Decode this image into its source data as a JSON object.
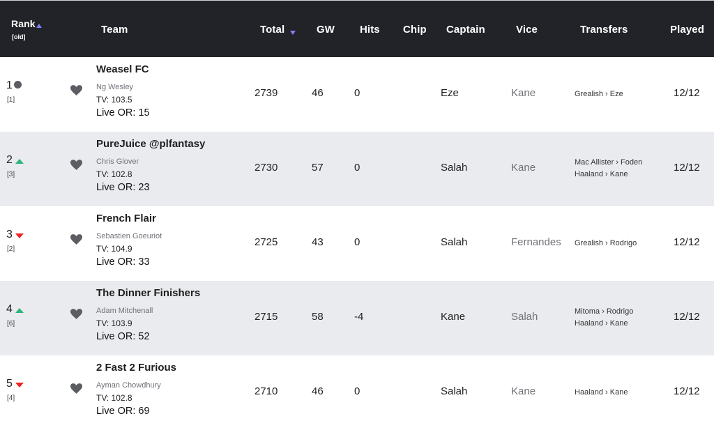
{
  "header": {
    "rank": "Rank",
    "rank_old": "[old]",
    "team": "Team",
    "total": "Total",
    "gw": "GW",
    "hits": "Hits",
    "chip": "Chip",
    "captain": "Captain",
    "vice": "Vice",
    "transfers": "Transfers",
    "played": "Played"
  },
  "colors": {
    "header_bg": "#212328",
    "alt_row_bg": "#e9ebee",
    "sort_indicator": "#7f7ff0",
    "rank_up": "#2db37c",
    "rank_down": "#ee2222",
    "rank_same": "#5b5d62"
  },
  "rows": [
    {
      "rank": "1",
      "old_rank": "[1]",
      "movement": "same",
      "team": "Weasel FC",
      "manager": "Ng Wesley",
      "tv": "TV: 103.5",
      "live_or": "Live OR: 15",
      "total": "2739",
      "gw": "46",
      "hits": "0",
      "chip": "",
      "captain": "Eze",
      "vice": "Kane",
      "transfers": [
        "Grealish › Eze"
      ],
      "played": "12/12"
    },
    {
      "rank": "2",
      "old_rank": "[3]",
      "movement": "up",
      "team": "PureJuice @plfantasy",
      "manager": "Chris Glover",
      "tv": "TV: 102.8",
      "live_or": "Live OR: 23",
      "total": "2730",
      "gw": "57",
      "hits": "0",
      "chip": "",
      "captain": "Salah",
      "vice": "Kane",
      "transfers": [
        "Mac Allister › Foden",
        "Haaland › Kane"
      ],
      "played": "12/12"
    },
    {
      "rank": "3",
      "old_rank": "[2]",
      "movement": "down",
      "team": "French Flair",
      "manager": "Sebastien Goeuriot",
      "tv": "TV: 104.9",
      "live_or": "Live OR: 33",
      "total": "2725",
      "gw": "43",
      "hits": "0",
      "chip": "",
      "captain": "Salah",
      "vice": "Fernandes",
      "transfers": [
        "Grealish › Rodrigo"
      ],
      "played": "12/12"
    },
    {
      "rank": "4",
      "old_rank": "[6]",
      "movement": "up",
      "team": "The Dinner Finishers",
      "manager": "Adam Mitchenall",
      "tv": "TV: 103.9",
      "live_or": "Live OR: 52",
      "total": "2715",
      "gw": "58",
      "hits": "-4",
      "chip": "",
      "captain": "Kane",
      "vice": "Salah",
      "transfers": [
        "Mitoma › Rodrigo",
        "Haaland › Kane"
      ],
      "played": "12/12"
    },
    {
      "rank": "5",
      "old_rank": "[4]",
      "movement": "down",
      "team": "2 Fast 2 Furious",
      "manager": "Ayman Chowdhury",
      "tv": "TV: 102.8",
      "live_or": "Live OR: 69",
      "total": "2710",
      "gw": "46",
      "hits": "0",
      "chip": "",
      "captain": "Salah",
      "vice": "Kane",
      "transfers": [
        "Haaland › Kane"
      ],
      "played": "12/12"
    }
  ]
}
